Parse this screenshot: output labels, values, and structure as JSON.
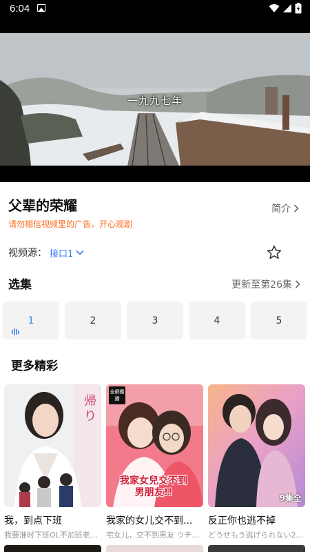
{
  "status_bar": {
    "time": "6:04"
  },
  "player": {
    "subtitle": "一九九七年"
  },
  "detail": {
    "title": "父辈的荣耀",
    "intro_label": "简介",
    "notice": "请勿相信视频里的广告，开心观剧",
    "source_label": "视频源：",
    "source_value": "接口1"
  },
  "episodes_section": {
    "heading": "选集",
    "update_text": "更新至第26集",
    "episodes": [
      "1",
      "2",
      "3",
      "4",
      "5"
    ],
    "active_episode": "1"
  },
  "more_section": {
    "heading": "更多精彩",
    "cards": [
      {
        "title": "我，到点下班",
        "subtitle": "我要准时下班OL不加班老娘..."
      },
      {
        "title": "我家的女儿交不到...",
        "subtitle": "宅女儿，交不到男友 ウチの...",
        "badge": "全網獨播",
        "poster_text": "我家女兒交不到男朋友!!"
      },
      {
        "title": "反正你也逃不掉",
        "subtitle": "どうせもう逃げられない2...",
        "badge_br": "9集全"
      }
    ]
  },
  "colors": {
    "accent": "#3d7df0",
    "notice": "#ff6a1a"
  }
}
